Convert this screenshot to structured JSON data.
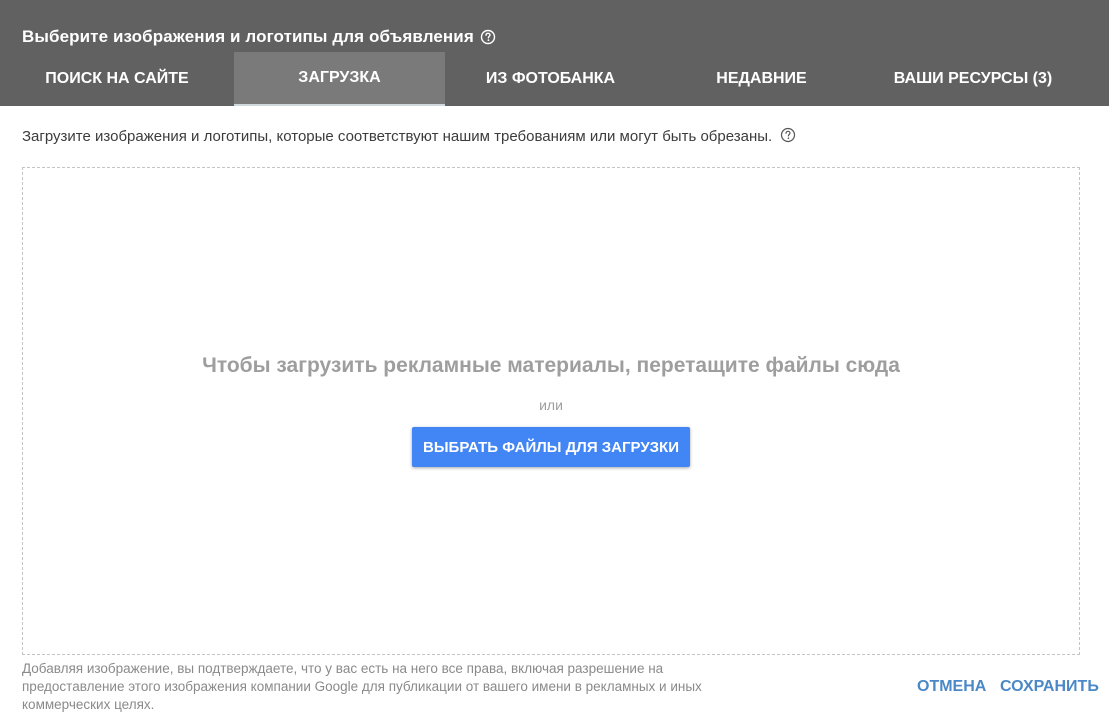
{
  "header": {
    "title": "Выберите изображения и логотипы для объявления",
    "help_icon": "question-circle-icon"
  },
  "tabs": [
    {
      "label": "ПОИСК НА САЙТЕ",
      "active": false
    },
    {
      "label": "ЗАГРУЗКА",
      "active": true
    },
    {
      "label": "ИЗ ФОТОБАНКА",
      "active": false
    },
    {
      "label": "НЕДАВНИЕ",
      "active": false
    },
    {
      "label": "ВАШИ РЕСУРСЫ (3)",
      "active": false
    }
  ],
  "instruction": {
    "text": "Загрузите изображения и логотипы, которые соответствуют нашим требованиям или могут быть обрезаны.",
    "help_icon": "question-circle-icon"
  },
  "dropzone": {
    "drop_text": "Чтобы загрузить рекламные материалы, перетащите файлы сюда",
    "or_text": "или",
    "button_label": "ВЫБРАТЬ ФАЙЛЫ ДЛЯ ЗАГРУЗКИ"
  },
  "footer": {
    "disclaimer": "Добавляя изображение, вы подтверждаете, что у вас есть на него все права, включая разрешение на предоставление этого изображения компании Google для публикации от вашего имени в рекламных и иных коммерческих целях.",
    "cancel_label": "ОТМЕНА",
    "save_label": "СОХРАНИТЬ"
  },
  "colors": {
    "header_bg": "#616161",
    "active_tab_bg": "#7a7a7a",
    "primary_button": "#4285f4",
    "link_text": "#4a88c7"
  }
}
